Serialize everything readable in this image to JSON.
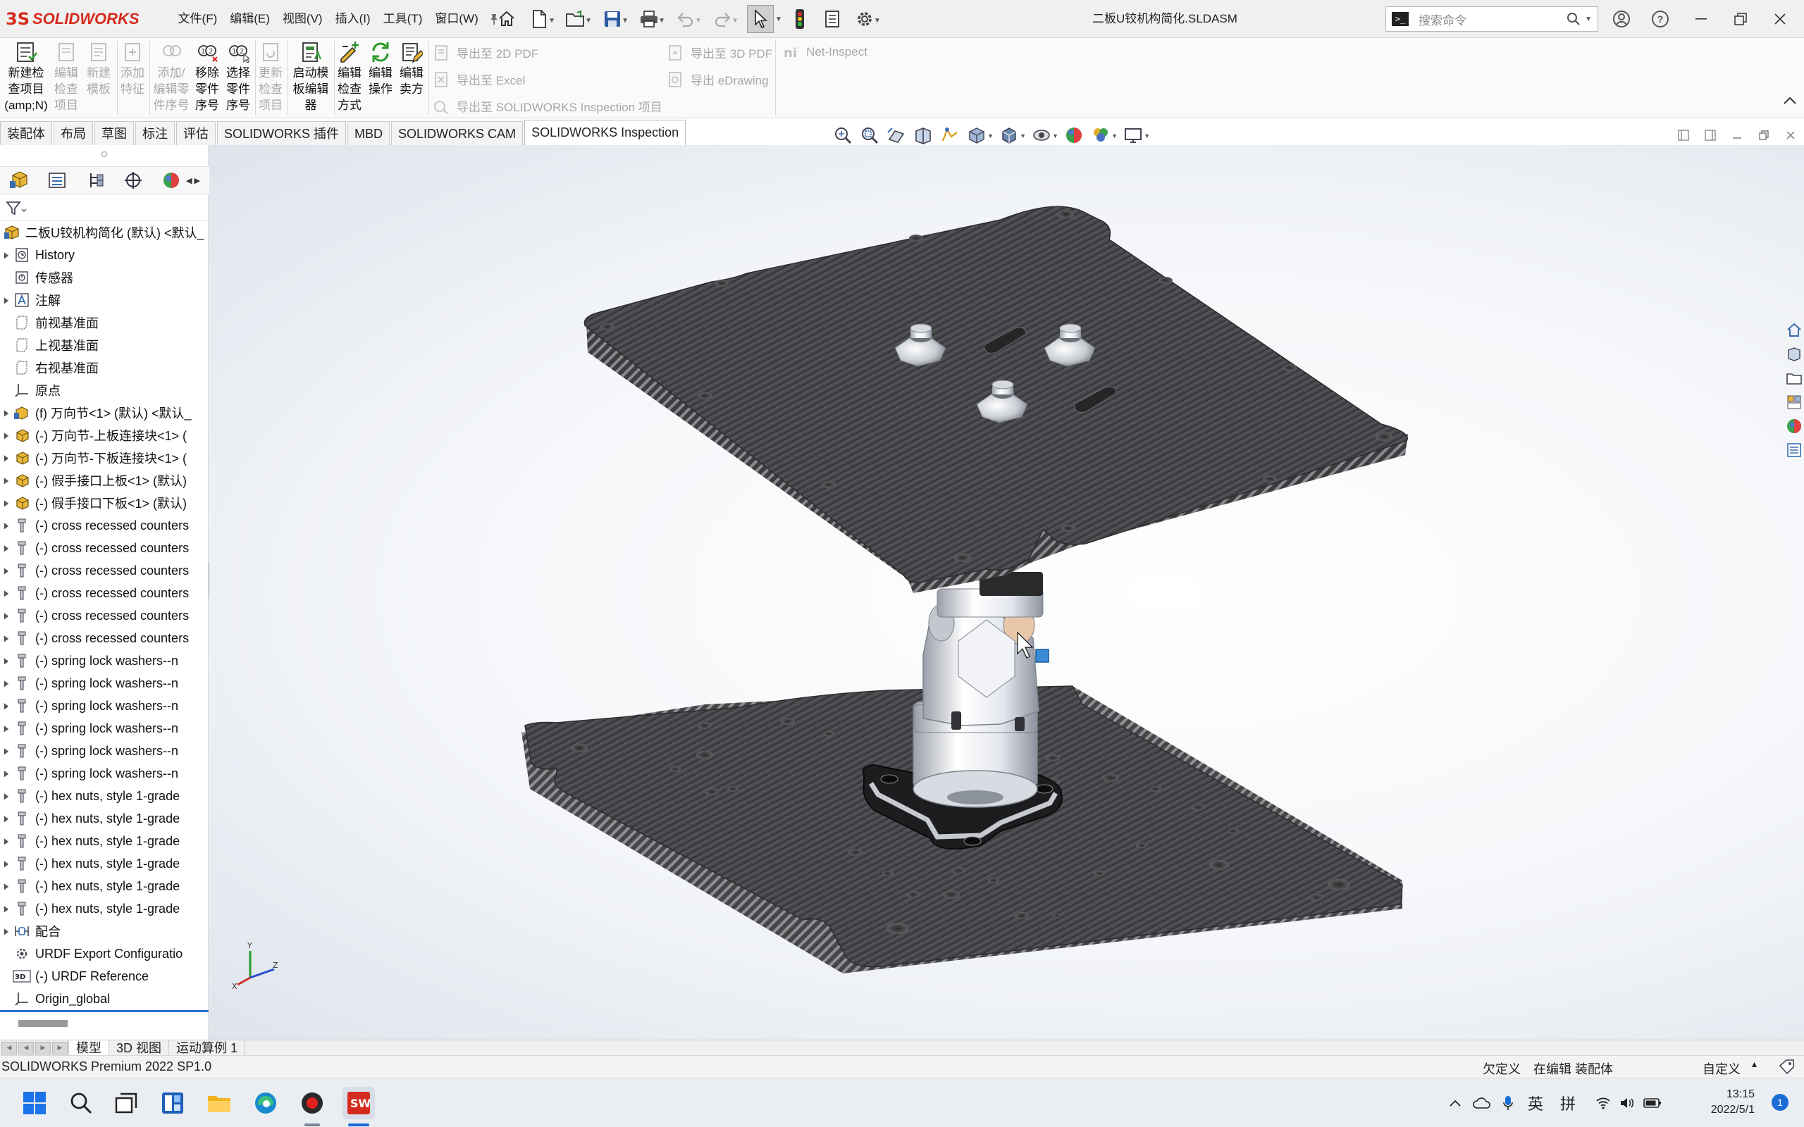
{
  "app": {
    "brand_mark": "3S",
    "brand_name": "SOLIDWORKS",
    "document_title": "二板U铰机构简化.SLDASM"
  },
  "menu": [
    "文件(F)",
    "编辑(E)",
    "视图(V)",
    "插入(I)",
    "工具(T)",
    "窗口(W)"
  ],
  "search": {
    "placeholder": "搜索命令"
  },
  "ribbon": {
    "buttons": [
      {
        "label": "新建检\n查项目\n(amp;N)",
        "enabled": true,
        "icon": "new-inspection-icon"
      },
      {
        "label": "编辑\n检查\n项目",
        "enabled": false,
        "icon": "edit-inspection-icon"
      },
      {
        "label": "新建\n模板",
        "enabled": false,
        "icon": "new-template-icon"
      },
      {
        "label": "添加\n特征",
        "enabled": false,
        "icon": "add-feature-icon"
      },
      {
        "label": "添加/\n编辑零\n件序号",
        "enabled": false,
        "icon": "add-balloon-icon"
      },
      {
        "label": "移除\n零件\n序号",
        "enabled": true,
        "icon": "remove-balloon-icon"
      },
      {
        "label": "选择\n零件\n序号",
        "enabled": true,
        "icon": "select-balloon-icon"
      },
      {
        "label": "更新\n检查\n项目",
        "enabled": false,
        "icon": "update-inspection-icon"
      },
      {
        "label": "启动模\n板编辑\n器",
        "enabled": true,
        "icon": "template-editor-icon"
      },
      {
        "label": "编辑\n检查\n方式",
        "enabled": true,
        "icon": "edit-method-icon"
      },
      {
        "label": "编辑\n操作",
        "enabled": true,
        "icon": "edit-operations-icon"
      },
      {
        "label": "编辑\n卖方",
        "enabled": true,
        "icon": "edit-vendor-icon"
      }
    ],
    "exports": [
      "导出至 2D PDF",
      "导出至 Excel",
      "导出至 SOLIDWORKS Inspection 项目",
      "导出至 3D PDF",
      "导出 eDrawing",
      "Net-Inspect"
    ]
  },
  "command_tabs": [
    "装配体",
    "布局",
    "草图",
    "标注",
    "评估",
    "SOLIDWORKS 插件",
    "MBD",
    "SOLIDWORKS CAM",
    "SOLIDWORKS Inspection"
  ],
  "active_command_tab": "SOLIDWORKS Inspection",
  "tree": {
    "root": "二板U铰机构简化 (默认) <默认_",
    "items": [
      {
        "label": "History",
        "icon": "history-icon",
        "expand": true
      },
      {
        "label": "传感器",
        "icon": "sensor-icon",
        "expand": false
      },
      {
        "label": "注解",
        "icon": "annotation-icon",
        "expand": true
      },
      {
        "label": "前视基准面",
        "icon": "plane-icon",
        "expand": false
      },
      {
        "label": "上视基准面",
        "icon": "plane-icon",
        "expand": false
      },
      {
        "label": "右视基准面",
        "icon": "plane-icon",
        "expand": false
      },
      {
        "label": "原点",
        "icon": "origin-icon",
        "expand": false
      },
      {
        "label": "(f) 万向节<1> (默认) <默认_",
        "icon": "subassembly-icon",
        "expand": true
      },
      {
        "label": "(-) 万向节-上板连接块<1> (",
        "icon": "part-icon",
        "expand": true
      },
      {
        "label": "(-) 万向节-下板连接块<1> (",
        "icon": "part-icon",
        "expand": true
      },
      {
        "label": "(-) 假手接口上板<1> (默认)",
        "icon": "part-icon",
        "expand": true
      },
      {
        "label": "(-) 假手接口下板<1> (默认)",
        "icon": "part-icon",
        "expand": true
      },
      {
        "label": "(-) cross recessed counters",
        "icon": "toolbox-icon",
        "expand": true
      },
      {
        "label": "(-) cross recessed counters",
        "icon": "toolbox-icon",
        "expand": true
      },
      {
        "label": "(-) cross recessed counters",
        "icon": "toolbox-icon",
        "expand": true
      },
      {
        "label": "(-) cross recessed counters",
        "icon": "toolbox-icon",
        "expand": true
      },
      {
        "label": "(-) cross recessed counters",
        "icon": "toolbox-icon",
        "expand": true
      },
      {
        "label": "(-) cross recessed counters",
        "icon": "toolbox-icon",
        "expand": true
      },
      {
        "label": "(-) spring lock washers--n",
        "icon": "toolbox-icon",
        "expand": true
      },
      {
        "label": "(-) spring lock washers--n",
        "icon": "toolbox-icon",
        "expand": true
      },
      {
        "label": "(-) spring lock washers--n",
        "icon": "toolbox-icon",
        "expand": true
      },
      {
        "label": "(-) spring lock washers--n",
        "icon": "toolbox-icon",
        "expand": true
      },
      {
        "label": "(-) spring lock washers--n",
        "icon": "toolbox-icon",
        "expand": true
      },
      {
        "label": "(-) spring lock washers--n",
        "icon": "toolbox-icon",
        "expand": true
      },
      {
        "label": "(-) hex nuts, style 1-grade",
        "icon": "toolbox-icon",
        "expand": true
      },
      {
        "label": "(-) hex nuts, style 1-grade",
        "icon": "toolbox-icon",
        "expand": true
      },
      {
        "label": "(-) hex nuts, style 1-grade",
        "icon": "toolbox-icon",
        "expand": true
      },
      {
        "label": "(-) hex nuts, style 1-grade",
        "icon": "toolbox-icon",
        "expand": true
      },
      {
        "label": "(-) hex nuts, style 1-grade",
        "icon": "toolbox-icon",
        "expand": true
      },
      {
        "label": "(-) hex nuts, style 1-grade",
        "icon": "toolbox-icon",
        "expand": true
      },
      {
        "label": "配合",
        "icon": "mates-icon",
        "expand": true
      },
      {
        "label": "URDF Export Configuratio",
        "icon": "urdf-config-icon",
        "expand": false
      },
      {
        "label": "(-) URDF Reference",
        "icon": "urdf-reference-icon",
        "expand": false
      },
      {
        "label": "Origin_global",
        "icon": "origin-icon",
        "expand": false
      }
    ]
  },
  "bottom_tabs": [
    "模型",
    "3D 视图",
    "运动算例 1"
  ],
  "active_bottom_tab": "模型",
  "status": {
    "version": "SOLIDWORKS Premium 2022 SP1.0",
    "definition": "欠定义",
    "mode": "在编辑 装配体",
    "units": "自定义",
    "units_caret": "▴"
  },
  "triad": {
    "x": "X",
    "y": "Y",
    "z": "Z"
  },
  "taskbar": {
    "ime_lang": "英",
    "ime_mode": "拼",
    "time": "13:15",
    "date": "2022/5/1",
    "notifications": "1"
  },
  "colors": {
    "brand": "#d52b1e",
    "accent": "#2a6fc9",
    "plate": "#4a4a4e"
  }
}
